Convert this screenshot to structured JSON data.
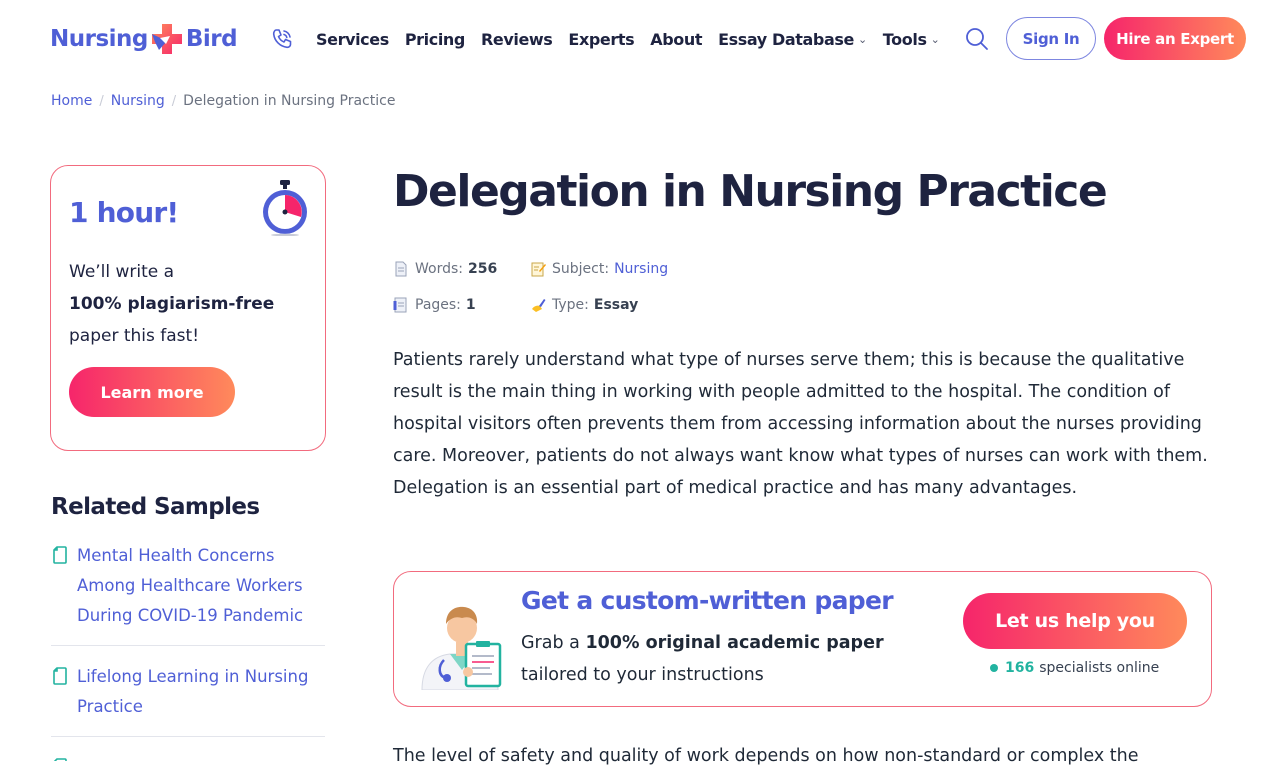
{
  "brand": {
    "name_left": "Nursing",
    "name_right": "Bird"
  },
  "nav": {
    "items": [
      {
        "label": "Services",
        "dropdown": false
      },
      {
        "label": "Pricing",
        "dropdown": false
      },
      {
        "label": "Reviews",
        "dropdown": false
      },
      {
        "label": "Experts",
        "dropdown": false
      },
      {
        "label": "About",
        "dropdown": false
      },
      {
        "label": "Essay Database",
        "dropdown": true
      },
      {
        "label": "Tools",
        "dropdown": true
      }
    ],
    "sign_in": "Sign In",
    "hire": "Hire an Expert"
  },
  "breadcrumb": {
    "home": "Home",
    "category": "Nursing",
    "current": "Delegation in Nursing Practice"
  },
  "promo": {
    "title": "1 hour!",
    "line1": "We’ll write a",
    "line2": "100% plagiarism-free",
    "line3": "paper this fast!",
    "button": "Learn more"
  },
  "related": {
    "title": "Related Samples",
    "items": [
      "Mental Health Concerns Among Healthcare Workers During COVID-19 Pandemic",
      "Lifelong Learning in Nursing Practice"
    ]
  },
  "article": {
    "title": "Delegation in Nursing Practice",
    "meta": {
      "words_label": "Words:",
      "words": "256",
      "subject_label": "Subject:",
      "subject": "Nursing",
      "pages_label": "Pages:",
      "pages": "1",
      "type_label": "Type:",
      "type": "Essay"
    },
    "paragraph1": "Patients rarely understand what type of nurses serve them; this is because the qualitative result is the main thing in working with people admitted to the hospital. The condition of hospital visitors often prevents them from accessing information about the nurses providing care. Moreover, patients do not always want know what types of nurses can work with them. Delegation is an essential part of medical practice and has many advantages.",
    "paragraph2": "The level of safety and quality of work depends on how non-standard or complex the"
  },
  "cta": {
    "title": "Get a custom-written paper",
    "text_prefix": "Grab a ",
    "text_bold": "100% original academic paper",
    "text_suffix": "tailored to your instructions",
    "button": "Let us help you",
    "online_count": "166",
    "online_label": "specialists online"
  },
  "colors": {
    "brand": "#4f5fd6",
    "accent_start": "#f6256b",
    "accent_end": "#ff8a5b",
    "online": "#22b3a0"
  }
}
